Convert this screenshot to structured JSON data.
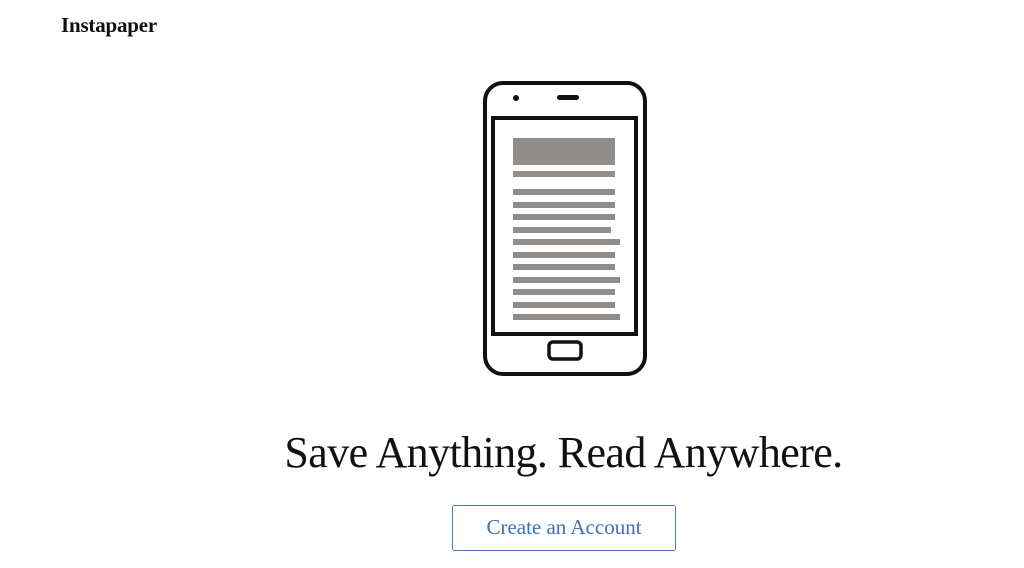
{
  "brand": {
    "name": "Instapaper"
  },
  "hero": {
    "illustration_icon": "phone-with-article-icon",
    "headline": "Save Anything. Read Anywhere."
  },
  "cta": {
    "label": "Create an Account",
    "color": "#3f6fb3"
  }
}
